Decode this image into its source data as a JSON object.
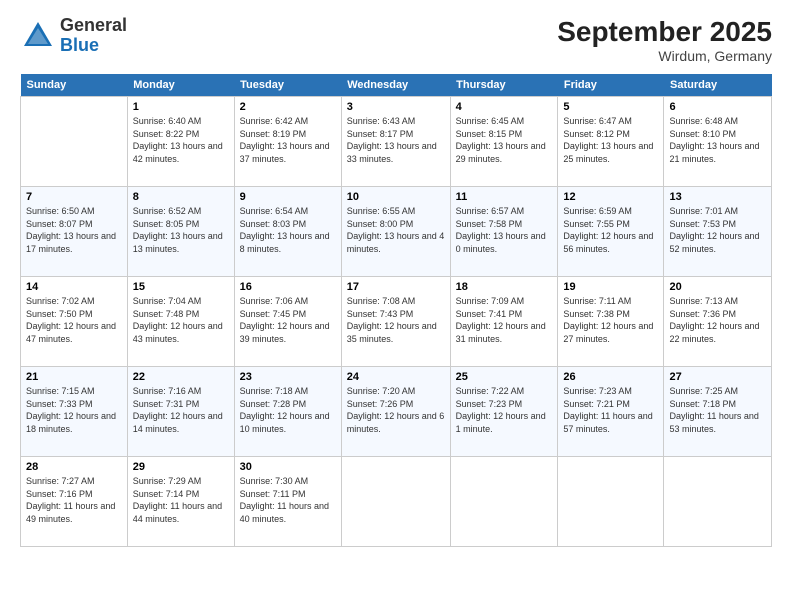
{
  "logo": {
    "general": "General",
    "blue": "Blue"
  },
  "header": {
    "title": "September 2025",
    "location": "Wirdum, Germany"
  },
  "weekdays": [
    "Sunday",
    "Monday",
    "Tuesday",
    "Wednesday",
    "Thursday",
    "Friday",
    "Saturday"
  ],
  "weeks": [
    [
      {
        "day": "",
        "sunrise": "",
        "sunset": "",
        "daylight": ""
      },
      {
        "day": "1",
        "sunrise": "Sunrise: 6:40 AM",
        "sunset": "Sunset: 8:22 PM",
        "daylight": "Daylight: 13 hours and 42 minutes."
      },
      {
        "day": "2",
        "sunrise": "Sunrise: 6:42 AM",
        "sunset": "Sunset: 8:19 PM",
        "daylight": "Daylight: 13 hours and 37 minutes."
      },
      {
        "day": "3",
        "sunrise": "Sunrise: 6:43 AM",
        "sunset": "Sunset: 8:17 PM",
        "daylight": "Daylight: 13 hours and 33 minutes."
      },
      {
        "day": "4",
        "sunrise": "Sunrise: 6:45 AM",
        "sunset": "Sunset: 8:15 PM",
        "daylight": "Daylight: 13 hours and 29 minutes."
      },
      {
        "day": "5",
        "sunrise": "Sunrise: 6:47 AM",
        "sunset": "Sunset: 8:12 PM",
        "daylight": "Daylight: 13 hours and 25 minutes."
      },
      {
        "day": "6",
        "sunrise": "Sunrise: 6:48 AM",
        "sunset": "Sunset: 8:10 PM",
        "daylight": "Daylight: 13 hours and 21 minutes."
      }
    ],
    [
      {
        "day": "7",
        "sunrise": "Sunrise: 6:50 AM",
        "sunset": "Sunset: 8:07 PM",
        "daylight": "Daylight: 13 hours and 17 minutes."
      },
      {
        "day": "8",
        "sunrise": "Sunrise: 6:52 AM",
        "sunset": "Sunset: 8:05 PM",
        "daylight": "Daylight: 13 hours and 13 minutes."
      },
      {
        "day": "9",
        "sunrise": "Sunrise: 6:54 AM",
        "sunset": "Sunset: 8:03 PM",
        "daylight": "Daylight: 13 hours and 8 minutes."
      },
      {
        "day": "10",
        "sunrise": "Sunrise: 6:55 AM",
        "sunset": "Sunset: 8:00 PM",
        "daylight": "Daylight: 13 hours and 4 minutes."
      },
      {
        "day": "11",
        "sunrise": "Sunrise: 6:57 AM",
        "sunset": "Sunset: 7:58 PM",
        "daylight": "Daylight: 13 hours and 0 minutes."
      },
      {
        "day": "12",
        "sunrise": "Sunrise: 6:59 AM",
        "sunset": "Sunset: 7:55 PM",
        "daylight": "Daylight: 12 hours and 56 minutes."
      },
      {
        "day": "13",
        "sunrise": "Sunrise: 7:01 AM",
        "sunset": "Sunset: 7:53 PM",
        "daylight": "Daylight: 12 hours and 52 minutes."
      }
    ],
    [
      {
        "day": "14",
        "sunrise": "Sunrise: 7:02 AM",
        "sunset": "Sunset: 7:50 PM",
        "daylight": "Daylight: 12 hours and 47 minutes."
      },
      {
        "day": "15",
        "sunrise": "Sunrise: 7:04 AM",
        "sunset": "Sunset: 7:48 PM",
        "daylight": "Daylight: 12 hours and 43 minutes."
      },
      {
        "day": "16",
        "sunrise": "Sunrise: 7:06 AM",
        "sunset": "Sunset: 7:45 PM",
        "daylight": "Daylight: 12 hours and 39 minutes."
      },
      {
        "day": "17",
        "sunrise": "Sunrise: 7:08 AM",
        "sunset": "Sunset: 7:43 PM",
        "daylight": "Daylight: 12 hours and 35 minutes."
      },
      {
        "day": "18",
        "sunrise": "Sunrise: 7:09 AM",
        "sunset": "Sunset: 7:41 PM",
        "daylight": "Daylight: 12 hours and 31 minutes."
      },
      {
        "day": "19",
        "sunrise": "Sunrise: 7:11 AM",
        "sunset": "Sunset: 7:38 PM",
        "daylight": "Daylight: 12 hours and 27 minutes."
      },
      {
        "day": "20",
        "sunrise": "Sunrise: 7:13 AM",
        "sunset": "Sunset: 7:36 PM",
        "daylight": "Daylight: 12 hours and 22 minutes."
      }
    ],
    [
      {
        "day": "21",
        "sunrise": "Sunrise: 7:15 AM",
        "sunset": "Sunset: 7:33 PM",
        "daylight": "Daylight: 12 hours and 18 minutes."
      },
      {
        "day": "22",
        "sunrise": "Sunrise: 7:16 AM",
        "sunset": "Sunset: 7:31 PM",
        "daylight": "Daylight: 12 hours and 14 minutes."
      },
      {
        "day": "23",
        "sunrise": "Sunrise: 7:18 AM",
        "sunset": "Sunset: 7:28 PM",
        "daylight": "Daylight: 12 hours and 10 minutes."
      },
      {
        "day": "24",
        "sunrise": "Sunrise: 7:20 AM",
        "sunset": "Sunset: 7:26 PM",
        "daylight": "Daylight: 12 hours and 6 minutes."
      },
      {
        "day": "25",
        "sunrise": "Sunrise: 7:22 AM",
        "sunset": "Sunset: 7:23 PM",
        "daylight": "Daylight: 12 hours and 1 minute."
      },
      {
        "day": "26",
        "sunrise": "Sunrise: 7:23 AM",
        "sunset": "Sunset: 7:21 PM",
        "daylight": "Daylight: 11 hours and 57 minutes."
      },
      {
        "day": "27",
        "sunrise": "Sunrise: 7:25 AM",
        "sunset": "Sunset: 7:18 PM",
        "daylight": "Daylight: 11 hours and 53 minutes."
      }
    ],
    [
      {
        "day": "28",
        "sunrise": "Sunrise: 7:27 AM",
        "sunset": "Sunset: 7:16 PM",
        "daylight": "Daylight: 11 hours and 49 minutes."
      },
      {
        "day": "29",
        "sunrise": "Sunrise: 7:29 AM",
        "sunset": "Sunset: 7:14 PM",
        "daylight": "Daylight: 11 hours and 44 minutes."
      },
      {
        "day": "30",
        "sunrise": "Sunrise: 7:30 AM",
        "sunset": "Sunset: 7:11 PM",
        "daylight": "Daylight: 11 hours and 40 minutes."
      },
      {
        "day": "",
        "sunrise": "",
        "sunset": "",
        "daylight": ""
      },
      {
        "day": "",
        "sunrise": "",
        "sunset": "",
        "daylight": ""
      },
      {
        "day": "",
        "sunrise": "",
        "sunset": "",
        "daylight": ""
      },
      {
        "day": "",
        "sunrise": "",
        "sunset": "",
        "daylight": ""
      }
    ]
  ]
}
